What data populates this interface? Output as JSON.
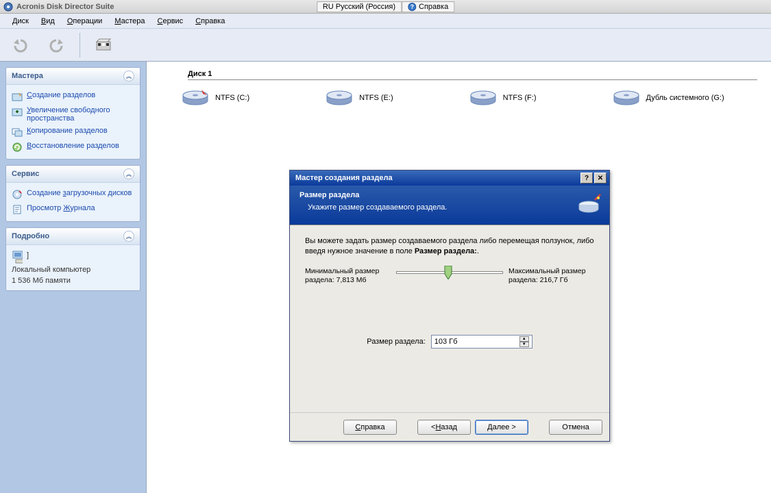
{
  "app": {
    "title": "Acronis Disk Director Suite",
    "lang_btn": "RU Русский (Россия)",
    "help_btn": "Справка"
  },
  "menu": {
    "m1": "Диск",
    "m2": "Вид",
    "m3": "Операции",
    "m4": "Мастера",
    "m5": "Сервис",
    "m6": "Справка",
    "u1": "Д",
    "u2": "В",
    "u3": "О",
    "u4": "М",
    "u5": "С",
    "u6": "С"
  },
  "sidebar": {
    "p1_title": "Мастера",
    "p1": {
      "i1": "Создание разделов",
      "i2": "Увеличение свободного пространства",
      "i3": "Копирование разделов",
      "i4": "Восстановление разделов"
    },
    "p2_title": "Сервис",
    "p2": {
      "i1": "Создание загрузочных дисков",
      "i2": "Просмотр Журнала"
    },
    "p3_title": "Подробно",
    "p3": {
      "name": "]",
      "host": "Локальный компьютер",
      "mem": "1 536 Мб памяти"
    }
  },
  "content": {
    "disk_title": "Диск 1",
    "d1": "NTFS (C:)",
    "d2": "NTFS (E:)",
    "d3": "NTFS (F:)",
    "d4": "Дубль системного (G:)"
  },
  "dialog": {
    "title": "Мастер создания раздела",
    "banner_title": "Размер раздела",
    "banner_sub": "Укажите размер создаваемого раздела.",
    "body_text1": "Вы можете задать размер создаваемого раздела либо перемещая ползунок, либо введя нужное значение в поле ",
    "body_text1b": "Размер раздела:",
    "min_label": "Минимальный размер раздела: 7,813 Мб",
    "max_label": "Максимальный размер раздела: 216,7 Гб",
    "size_label": "Размер раздела:",
    "size_value": "103 Гб",
    "btn_help": "Справка",
    "btn_back": "< Назад",
    "btn_next": "Далее >",
    "btn_cancel": "Отмена"
  }
}
